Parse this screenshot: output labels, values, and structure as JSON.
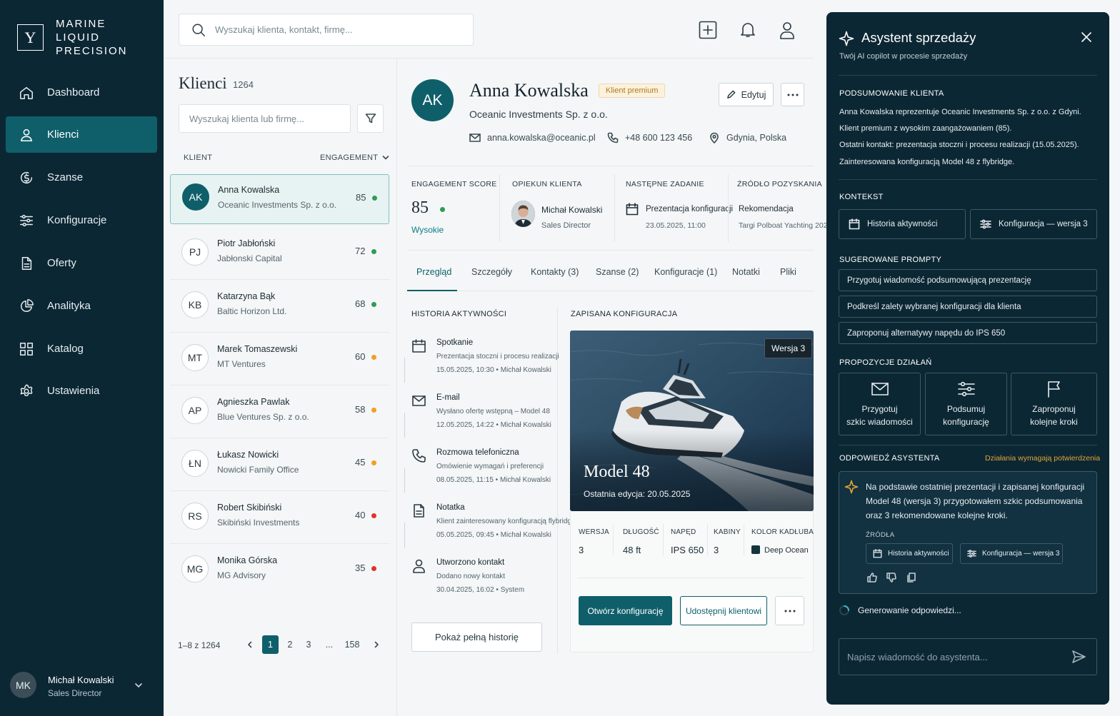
{
  "brand": {
    "logo_letter": "Y",
    "name": "MARINE LIQUID PRECISION"
  },
  "nav": [
    {
      "label": "Dashboard",
      "icon": "home-icon"
    },
    {
      "label": "Klienci",
      "icon": "user-icon",
      "active": true
    },
    {
      "label": "Szanse",
      "icon": "dollar-circle-icon"
    },
    {
      "label": "Konfiguracje",
      "icon": "sliders-icon"
    },
    {
      "label": "Oferty",
      "icon": "document-icon"
    },
    {
      "label": "Analityka",
      "icon": "pie-chart-icon"
    },
    {
      "label": "Katalog",
      "icon": "grid-icon"
    },
    {
      "label": "Ustawienia",
      "icon": "gear-icon"
    }
  ],
  "user": {
    "initials": "MK",
    "name": "Michał Kowalski",
    "role": "Sales Director"
  },
  "topbar": {
    "search_placeholder": "Wyszukaj klienta, kontakt, firmę..."
  },
  "clients": {
    "title": "Klienci",
    "count": "1264",
    "search_placeholder": "Wyszukaj klienta lub firmę...",
    "col_client": "KLIENT",
    "col_engagement": "ENGAGEMENT",
    "rows": [
      {
        "initials": "AK",
        "name": "Anna Kowalska",
        "company": "Oceanic Investments Sp. z o.o.",
        "score": "85",
        "status": "#2e9c55"
      },
      {
        "initials": "PJ",
        "name": "Piotr Jabłoński",
        "company": "Jabłonski Capital",
        "score": "72",
        "status": "#2e9c55"
      },
      {
        "initials": "KB",
        "name": "Katarzyna Bąk",
        "company": "Baltic Horizon Ltd.",
        "score": "68",
        "status": "#2e9c55"
      },
      {
        "initials": "MT",
        "name": "Marek Tomaszewski",
        "company": "MT Ventures",
        "score": "60",
        "status": "#f0a024"
      },
      {
        "initials": "AP",
        "name": "Agnieszka Pawlak",
        "company": "Blue Ventures Sp. z o.o.",
        "score": "58",
        "status": "#f0a024"
      },
      {
        "initials": "ŁN",
        "name": "Łukasz Nowicki",
        "company": "Nowicki Family Office",
        "score": "45",
        "status": "#f0a024"
      },
      {
        "initials": "RS",
        "name": "Robert Skibiński",
        "company": "Skibiński Investments",
        "score": "40",
        "status": "#e0342b"
      },
      {
        "initials": "MG",
        "name": "Monika Górska",
        "company": "MG Advisory",
        "score": "35",
        "status": "#e0342b"
      }
    ],
    "pagination": {
      "info": "1–8 z 1264",
      "pages": [
        "1",
        "2",
        "3",
        "...",
        "158"
      ],
      "current": "1"
    }
  },
  "detail": {
    "initials": "AK",
    "name": "Anna Kowalska",
    "badge": "Klient premium",
    "company": "Oceanic Investments Sp. z o.o.",
    "email": "anna.kowalska@oceanic.pl",
    "phone": "+48 600 123 456",
    "location": "Gdynia, Polska",
    "edit_label": "Edytuj",
    "stats": {
      "engagement_label": "ENGAGEMENT SCORE",
      "engagement_value": "85",
      "engagement_level": "Wysokie",
      "owner_label": "OPIEKUN KLIENTA",
      "owner_name": "Michał Kowalski",
      "owner_role": "Sales Director",
      "task_label": "NASTĘPNE ZADANIE",
      "task_name": "Prezentacja konfiguracji",
      "task_date": "23.05.2025, 11:00",
      "source_label": "ŹRÓDŁO POZYSKANIA",
      "source_name": "Rekomendacja",
      "source_sub": "Targi Polboat Yachting 2024"
    },
    "tabs": [
      "Przegląd",
      "Szczegóły",
      "Kontakty (3)",
      "Szanse (2)",
      "Konfiguracje (1)",
      "Notatki",
      "Pliki"
    ],
    "history_title": "HISTORIA AKTYWNOŚCI",
    "history": [
      {
        "icon": "calendar-icon",
        "title": "Spotkanie",
        "desc": "Prezentacja stoczni i procesu realizacji",
        "meta": "15.05.2025, 10:30 • Michał Kowalski"
      },
      {
        "icon": "mail-icon",
        "title": "E-mail",
        "desc": "Wysłano ofertę wstępną – Model 48",
        "meta": "12.05.2025, 14:22 • Michał Kowalski"
      },
      {
        "icon": "phone-icon",
        "title": "Rozmowa telefoniczna",
        "desc": "Omówienie wymagań i preferencji",
        "meta": "08.05.2025, 11:15 • Michał Kowalski"
      },
      {
        "icon": "note-icon",
        "title": "Notatka",
        "desc": "Klient zainteresowany konfiguracją flybridge",
        "meta": "05.05.2025, 09:45 • Michał Kowalski"
      },
      {
        "icon": "person-icon",
        "title": "Utworzono kontakt",
        "desc": "Dodano nowy kontakt",
        "meta": "30.04.2025, 16:02 • System"
      }
    ],
    "history_button": "Pokaż pełną historię",
    "config": {
      "title": "ZAPISANA KONFIGURACJA",
      "version_badge": "Wersja 3",
      "model": "Model 48",
      "last_edit": "Ostatnia edycja: 20.05.2025",
      "specs": [
        {
          "label": "WERSJA",
          "value": "3"
        },
        {
          "label": "DŁUGOŚĆ",
          "value": "48 ft"
        },
        {
          "label": "NAPĘD",
          "value": "IPS 650"
        },
        {
          "label": "KABINY",
          "value": "3"
        },
        {
          "label": "KOLOR KADŁUBA",
          "value": "Deep Ocean",
          "swatch": "#14343d"
        }
      ],
      "open_button": "Otwórz konfigurację",
      "share_button": "Udostępnij klientowi"
    }
  },
  "assistant": {
    "title": "Asystent sprzedaży",
    "subtitle": "Twój AI copilot w procesie sprzedaży",
    "summary_title": "PODSUMOWANIE KLIENTA",
    "summary": [
      "Anna Kowalska reprezentuje Oceanic Investments Sp. z o.o. z Gdyni.",
      "Klient premium z wysokim zaangażowaniem (85).",
      "Ostatni kontakt: prezentacja stoczni i procesu realizacji (15.05.2025).",
      "Zainteresowana konfiguracją Model 48 z flybridge."
    ],
    "context_title": "KONTEKST",
    "context": [
      "Historia aktywności",
      "Konfiguracja — wersja 3"
    ],
    "prompts_title": "SUGEROWANE PROMPTY",
    "prompts": [
      "Przygotuj wiadomość podsumowującą prezentację",
      "Podkreśl zalety wybranej konfiguracji dla klienta",
      "Zaproponuj alternatywy napędu do IPS 650"
    ],
    "actions_title": "PROPOZYCJE DZIAŁAŃ",
    "actions": [
      {
        "line1": "Przygotuj",
        "line2": "szkic wiadomości",
        "icon": "mail-icon"
      },
      {
        "line1": "Podsumuj",
        "line2": "konfigurację",
        "icon": "sliders-icon"
      },
      {
        "line1": "Zaproponuj",
        "line2": "kolejne kroki",
        "icon": "flag-icon"
      }
    ],
    "response_title": "ODPOWIEDŹ ASYSTENTA",
    "response_warning": "Działania wymagają potwierdzenia",
    "response_text": "Na podstawie ostatniej prezentacji i zapisanej konfiguracji Model 48 (wersja 3) przygotowałem szkic podsumowania oraz 3 rekomendowane kolejne kroki.",
    "sources_label": "ŹRÓDŁA",
    "sources": [
      "Historia aktywności",
      "Konfiguracja — wersja 3"
    ],
    "generating": "Generowanie odpowiedzi...",
    "input_placeholder": "Napisz wiadomość do asystenta..."
  }
}
